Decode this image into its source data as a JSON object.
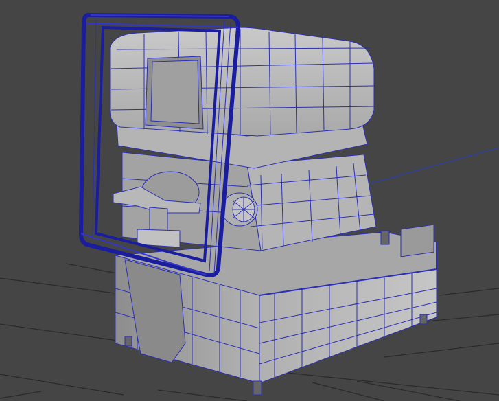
{
  "viewport": {
    "background_color": "#454545",
    "grid_color": "#2a2a2a",
    "axis_line_color": "#2d3fa8",
    "mesh_fill_light": "#b9b9b9",
    "mesh_fill_mid": "#9d9d9d",
    "mesh_fill_dark": "#7c7c7c",
    "wire_color": "#2b2fb8",
    "selection_color": "#1a1d9e",
    "model_icon": "3d-wireframe-model"
  }
}
